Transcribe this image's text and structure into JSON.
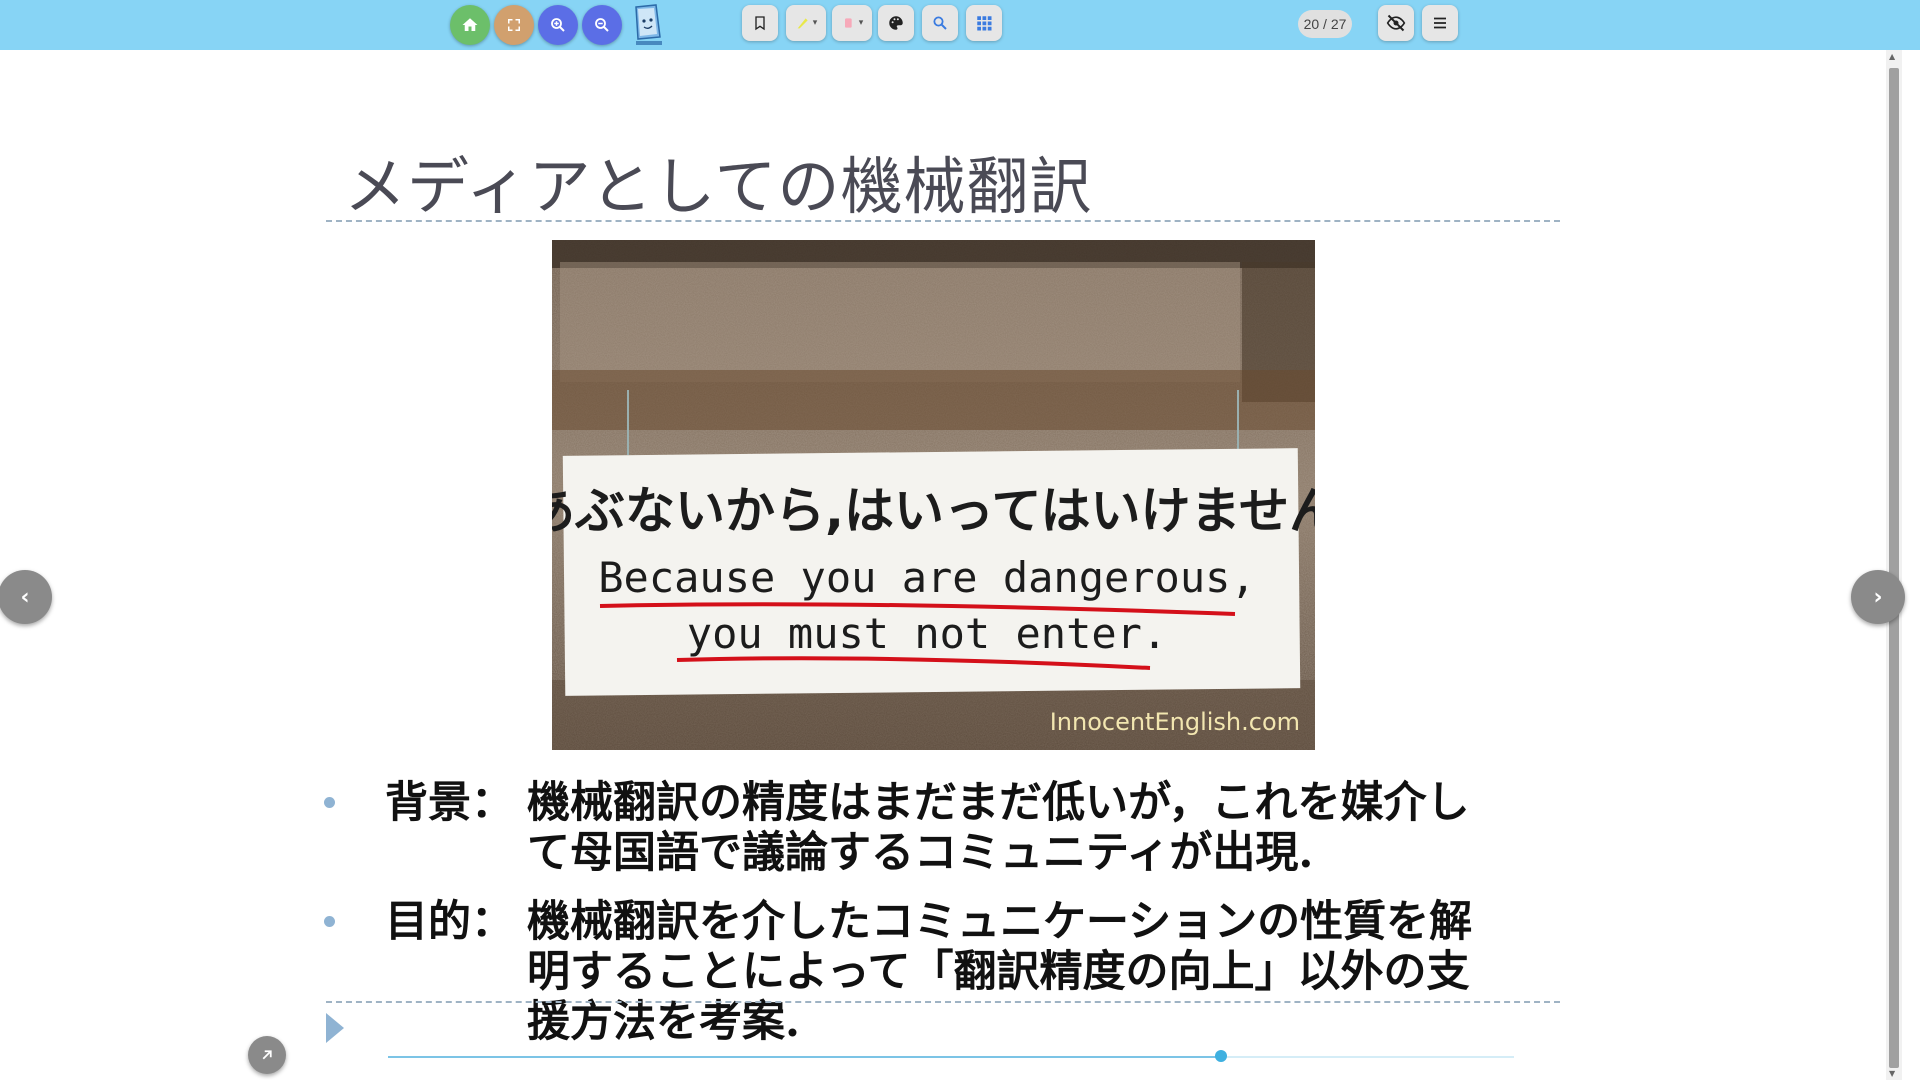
{
  "toolbar": {
    "buttons": [
      {
        "name": "home-button",
        "icon": "home-icon",
        "color": "#6cbf6a"
      },
      {
        "name": "fullscreen-button",
        "icon": "fullscreen-icon",
        "color": "#d1a06e"
      },
      {
        "name": "zoom-in-button",
        "icon": "zoom-in-icon",
        "color": "#5b6ee6"
      },
      {
        "name": "zoom-out-button",
        "icon": "zoom-out-icon",
        "color": "#5b6ee6"
      }
    ],
    "tools": [
      "bookmark-icon",
      "highlighter-icon",
      "eraser-icon",
      "palette-icon",
      "search-icon",
      "grid-icon"
    ],
    "page_counter": "20 / 27",
    "right_buttons": [
      "hide-icon",
      "menu-icon"
    ]
  },
  "slide": {
    "title": "メディアとしての機械翻訳",
    "bullets": [
      {
        "lead": "背景：",
        "line1": "機械翻訳の精度はまだまだ低いが，これを媒介し",
        "line2": "て母国語で議論するコミュニティが出現."
      },
      {
        "lead": "目的：",
        "line1": "機械翻訳を介したコミュニケーションの性質を解",
        "line2": "明することによって「翻訳精度の向上」以外の支",
        "line3": "援方法を考案."
      }
    ],
    "photo": {
      "sign_jp": "あぶないから,はいってはいけません",
      "sign_en_line1": "Because you are dangerous,",
      "sign_en_line2": "you must not enter.",
      "watermark": "InnocentEnglish.com"
    }
  },
  "progress": {
    "current": 20,
    "total": 27,
    "fraction": 0.74
  },
  "colors": {
    "toolbar_bg": "#87d4f5",
    "bullet": "#8fb3d3",
    "title": "#4a4a55",
    "progress": "#3fb0e0"
  }
}
